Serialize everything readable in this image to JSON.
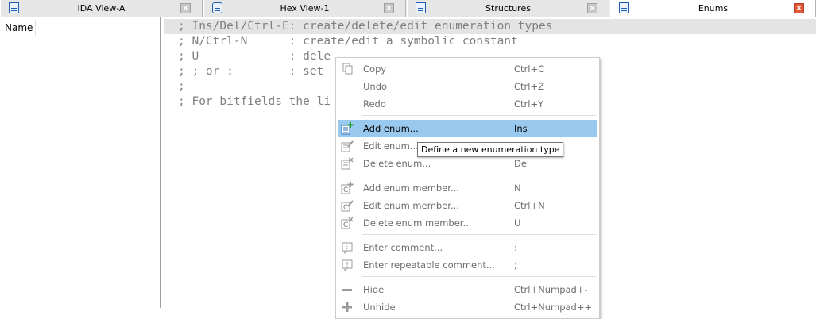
{
  "tabs": [
    {
      "label": "IDA View-A",
      "icon": "listing-icon",
      "active": false
    },
    {
      "label": "Hex View-1",
      "icon": "hex-icon",
      "active": false
    },
    {
      "label": "Structures",
      "icon": "structure-icon",
      "active": false
    },
    {
      "label": "Enums",
      "icon": "enum-icon",
      "active": true
    }
  ],
  "left_panel": {
    "header": "Name"
  },
  "listing": [
    "; Ins/Del/Ctrl-E: create/delete/edit enumeration types",
    "; N/Ctrl-N      : create/edit a symbolic constant",
    "; U             : dele",
    "; ; or :        : set",
    ";",
    "; For bitfields the li"
  ],
  "menu": {
    "items": [
      {
        "label": "Copy",
        "shortcut": "Ctrl+C",
        "icon": "copy-icon",
        "enabled": false
      },
      {
        "label": "Undo",
        "shortcut": "Ctrl+Z",
        "icon": "",
        "enabled": false
      },
      {
        "label": "Redo",
        "shortcut": "Ctrl+Y",
        "icon": "",
        "enabled": false
      },
      {
        "label": "Add enum...",
        "shortcut": "Ins",
        "icon": "add-enum-icon",
        "enabled": true,
        "highlighted": true
      },
      {
        "label": "Edit enum...",
        "shortcut": "",
        "icon": "edit-enum-icon",
        "enabled": false
      },
      {
        "label": "Delete enum...",
        "shortcut": "Del",
        "icon": "delete-enum-icon",
        "enabled": false
      },
      {
        "label": "Add enum member...",
        "shortcut": "N",
        "icon": "add-member-icon",
        "enabled": false
      },
      {
        "label": "Edit enum member...",
        "shortcut": "Ctrl+N",
        "icon": "edit-member-icon",
        "enabled": false
      },
      {
        "label": "Delete enum member...",
        "shortcut": "U",
        "icon": "delete-member-icon",
        "enabled": false
      },
      {
        "label": "Enter comment...",
        "shortcut": ":",
        "icon": "comment-icon",
        "enabled": false
      },
      {
        "label": "Enter repeatable comment...",
        "shortcut": ";",
        "icon": "repeatable-comment-icon",
        "enabled": false
      },
      {
        "label": "Hide",
        "shortcut": "Ctrl+Numpad+-",
        "icon": "hide-icon",
        "enabled": false
      },
      {
        "label": "Unhide",
        "shortcut": "Ctrl+Numpad++",
        "icon": "unhide-icon",
        "enabled": false
      }
    ],
    "tooltip": "Define a new enumeration type"
  },
  "colors": {
    "highlight": "#99c9ef",
    "close_active": "#e0573a",
    "listing_text": "#808080"
  }
}
